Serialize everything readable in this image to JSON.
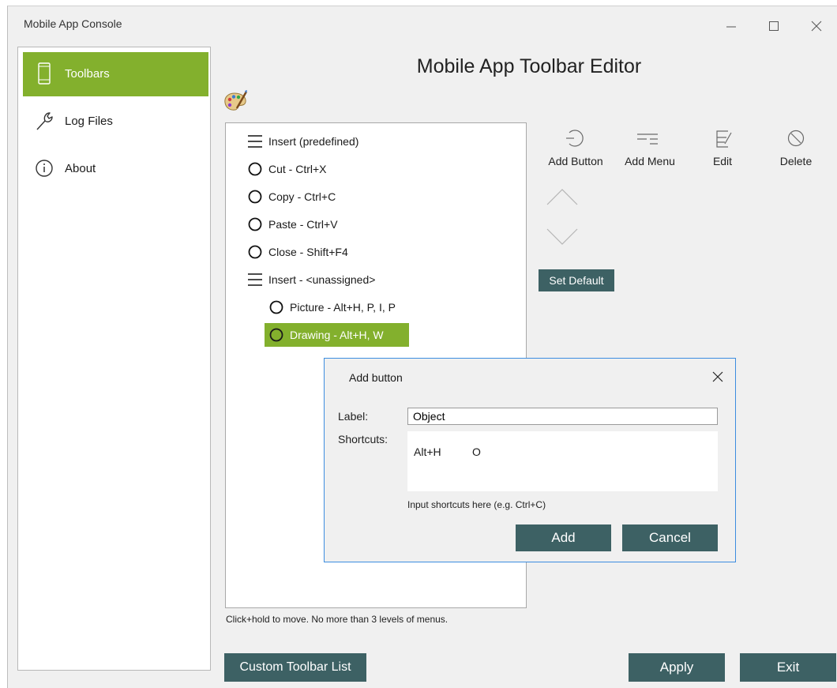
{
  "window": {
    "title": "Mobile App Console"
  },
  "sidebar": {
    "items": [
      {
        "label": "Toolbars",
        "icon": "phone-icon",
        "active": true
      },
      {
        "label": "Log Files",
        "icon": "wrench-icon",
        "active": false
      },
      {
        "label": "About",
        "icon": "info-icon",
        "active": false
      }
    ]
  },
  "main": {
    "title": "Mobile App Toolbar Editor",
    "tree": [
      {
        "label": "Insert (predefined)",
        "icon": "menu-lines-icon",
        "level": 0
      },
      {
        "label": "Cut - Ctrl+X",
        "icon": "circle-icon",
        "level": 0
      },
      {
        "label": "Copy - Ctrl+C",
        "icon": "circle-icon",
        "level": 0
      },
      {
        "label": "Paste - Ctrl+V",
        "icon": "circle-icon",
        "level": 0
      },
      {
        "label": "Close - Shift+F4",
        "icon": "circle-icon",
        "level": 0
      },
      {
        "label": "Insert - <unassigned>",
        "icon": "menu-lines-icon",
        "level": 0
      },
      {
        "label": "Picture - Alt+H, P, I, P",
        "icon": "circle-icon",
        "level": 1
      },
      {
        "label": "Drawing  - Alt+H, W",
        "icon": "circle-icon",
        "level": 1,
        "selected": true
      }
    ],
    "hint": "Click+hold to move. No more than 3 levels of menus.",
    "tools": {
      "add_button": "Add Button",
      "add_menu": "Add Menu",
      "edit": "Edit",
      "delete": "Delete"
    },
    "set_default": "Set Default",
    "custom_toolbar_list": "Custom Toolbar List",
    "apply": "Apply",
    "exit": "Exit"
  },
  "dialog": {
    "title": "Add button",
    "label_caption": "Label:",
    "label_value": "Object",
    "shortcuts_caption": "Shortcuts:",
    "shortcuts": [
      "Alt+H",
      "O"
    ],
    "hint": "Input shortcuts here (e.g. Ctrl+C)",
    "add": "Add",
    "cancel": "Cancel"
  },
  "colors": {
    "accent_green": "#83b02d",
    "dark_button": "#3d6164",
    "dialog_border": "#3c8de0"
  }
}
